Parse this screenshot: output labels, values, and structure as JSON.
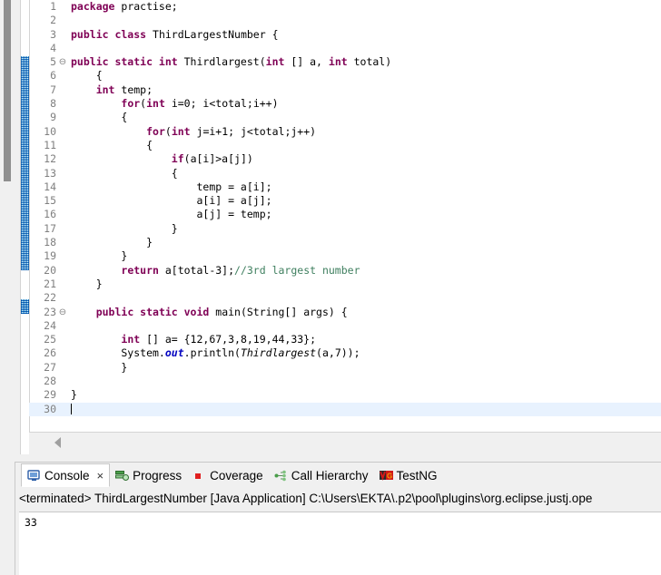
{
  "editor": {
    "language": "java",
    "current_line": 30,
    "fold_lines": [
      5,
      23
    ],
    "lines": [
      {
        "n": 1,
        "segs": [
          {
            "t": "package ",
            "c": "kw"
          },
          {
            "t": "practise;",
            "c": ""
          }
        ]
      },
      {
        "n": 2,
        "segs": []
      },
      {
        "n": 3,
        "segs": [
          {
            "t": "public class ",
            "c": "kw"
          },
          {
            "t": "ThirdLargestNumber {",
            "c": ""
          }
        ]
      },
      {
        "n": 4,
        "segs": []
      },
      {
        "n": 5,
        "segs": [
          {
            "t": "public static int ",
            "c": "kw"
          },
          {
            "t": "Thirdlargest(",
            "c": ""
          },
          {
            "t": "int",
            "c": "kw"
          },
          {
            "t": " [] a, ",
            "c": ""
          },
          {
            "t": "int",
            "c": "kw"
          },
          {
            "t": " total)",
            "c": ""
          }
        ],
        "fold": true
      },
      {
        "n": 6,
        "segs": [
          {
            "t": "    {",
            "c": ""
          }
        ]
      },
      {
        "n": 7,
        "segs": [
          {
            "t": "    ",
            "c": ""
          },
          {
            "t": "int",
            "c": "kw"
          },
          {
            "t": " temp;",
            "c": ""
          }
        ]
      },
      {
        "n": 8,
        "segs": [
          {
            "t": "        ",
            "c": ""
          },
          {
            "t": "for",
            "c": "kw"
          },
          {
            "t": "(",
            "c": ""
          },
          {
            "t": "int",
            "c": "kw"
          },
          {
            "t": " i=0; i<total;i++)",
            "c": ""
          }
        ]
      },
      {
        "n": 9,
        "segs": [
          {
            "t": "        {",
            "c": ""
          }
        ]
      },
      {
        "n": 10,
        "segs": [
          {
            "t": "            ",
            "c": ""
          },
          {
            "t": "for",
            "c": "kw"
          },
          {
            "t": "(",
            "c": ""
          },
          {
            "t": "int",
            "c": "kw"
          },
          {
            "t": " j=i+1; j<total;j++)",
            "c": ""
          }
        ]
      },
      {
        "n": 11,
        "segs": [
          {
            "t": "            {",
            "c": ""
          }
        ]
      },
      {
        "n": 12,
        "segs": [
          {
            "t": "                ",
            "c": ""
          },
          {
            "t": "if",
            "c": "kw"
          },
          {
            "t": "(a[i]>a[j])",
            "c": ""
          }
        ]
      },
      {
        "n": 13,
        "segs": [
          {
            "t": "                {",
            "c": ""
          }
        ]
      },
      {
        "n": 14,
        "segs": [
          {
            "t": "                    temp = a[i];",
            "c": ""
          }
        ]
      },
      {
        "n": 15,
        "segs": [
          {
            "t": "                    a[i] = a[j];",
            "c": ""
          }
        ]
      },
      {
        "n": 16,
        "segs": [
          {
            "t": "                    a[j] = temp;",
            "c": ""
          }
        ]
      },
      {
        "n": 17,
        "segs": [
          {
            "t": "                }",
            "c": ""
          }
        ]
      },
      {
        "n": 18,
        "segs": [
          {
            "t": "            }",
            "c": ""
          }
        ]
      },
      {
        "n": 19,
        "segs": [
          {
            "t": "        }",
            "c": ""
          }
        ]
      },
      {
        "n": 20,
        "segs": [
          {
            "t": "        ",
            "c": ""
          },
          {
            "t": "return",
            "c": "kw"
          },
          {
            "t": " a[total-3];",
            "c": ""
          },
          {
            "t": "//3rd largest number",
            "c": "cmt"
          }
        ]
      },
      {
        "n": 21,
        "segs": [
          {
            "t": "    }",
            "c": ""
          }
        ]
      },
      {
        "n": 22,
        "segs": []
      },
      {
        "n": 23,
        "segs": [
          {
            "t": "    ",
            "c": ""
          },
          {
            "t": "public static void ",
            "c": "kw"
          },
          {
            "t": "main(String[] args) {",
            "c": ""
          }
        ],
        "fold": true
      },
      {
        "n": 24,
        "segs": []
      },
      {
        "n": 25,
        "segs": [
          {
            "t": "        ",
            "c": ""
          },
          {
            "t": "int",
            "c": "kw"
          },
          {
            "t": " [] a= {12,67,3,8,19,44,33};",
            "c": ""
          }
        ]
      },
      {
        "n": 26,
        "segs": [
          {
            "t": "        System.",
            "c": ""
          },
          {
            "t": "out",
            "c": "sfld"
          },
          {
            "t": ".println(",
            "c": ""
          },
          {
            "t": "Thirdlargest",
            "c": "ital"
          },
          {
            "t": "(a,7));",
            "c": ""
          }
        ]
      },
      {
        "n": 27,
        "segs": [
          {
            "t": "        }",
            "c": ""
          }
        ]
      },
      {
        "n": 28,
        "segs": []
      },
      {
        "n": 29,
        "segs": [
          {
            "t": "}",
            "c": ""
          }
        ]
      },
      {
        "n": 30,
        "segs": [],
        "caret": true
      }
    ]
  },
  "console": {
    "tabs": [
      {
        "label": "Console",
        "icon": "console-icon",
        "active": true,
        "closable": true
      },
      {
        "label": "Progress",
        "icon": "progress-icon",
        "active": false,
        "closable": false
      },
      {
        "label": "Coverage",
        "icon": "coverage-icon",
        "active": false,
        "closable": false
      },
      {
        "label": "Call Hierarchy",
        "icon": "call-hierarchy-icon",
        "active": false,
        "closable": false
      },
      {
        "label": "TestNG",
        "icon": "testng-icon",
        "active": false,
        "closable": false
      }
    ],
    "close_glyph": "×",
    "launch_line": "<terminated> ThirdLargestNumber [Java Application] C:\\Users\\EKTA\\.p2\\pool\\plugins\\org.eclipse.justj.ope",
    "output": "33"
  },
  "colors": {
    "keyword": "#7F0055",
    "comment": "#3F7F5F",
    "static_field": "#0000C0",
    "line_number": "#808080",
    "current_line_bg": "#E8F2FE",
    "change_bar": "#0F7EC8",
    "panel_bg": "#F0F0F0"
  }
}
